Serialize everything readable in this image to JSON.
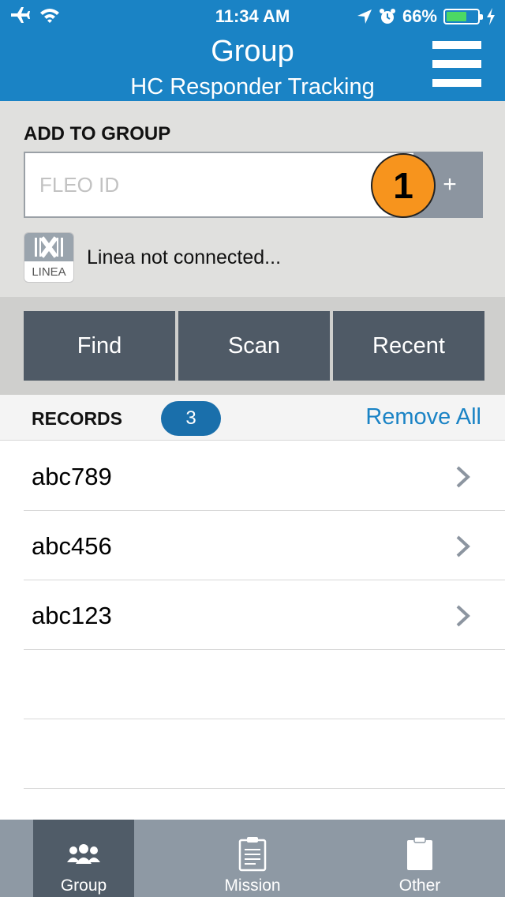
{
  "status_bar": {
    "time": "11:34 AM",
    "battery": "66%",
    "battery_level": 0.66
  },
  "header": {
    "title": "Group",
    "subtitle": "HC Responder Tracking",
    "menu_icon": "hamburger-menu-icon"
  },
  "add_group": {
    "label": "ADD TO GROUP",
    "input_placeholder": "FLEO ID",
    "input_value": "",
    "add_button_label": "+",
    "callout_number": "1",
    "linea_icon_text": "LINEA",
    "linea_status": "Linea not connected..."
  },
  "actions": {
    "find": "Find",
    "scan": "Scan",
    "recent": "Recent"
  },
  "records": {
    "label": "RECORDS",
    "count": "3",
    "remove_all": "Remove All",
    "items": [
      {
        "label": "abc789"
      },
      {
        "label": "abc456"
      },
      {
        "label": "abc123"
      }
    ]
  },
  "tabs": [
    {
      "label": "Group",
      "icon": "people-icon",
      "active": true
    },
    {
      "label": "Mission",
      "icon": "clipboard-document-icon",
      "active": false
    },
    {
      "label": "Other",
      "icon": "clipboard-blank-icon",
      "active": false
    }
  ],
  "colors": {
    "header": "#1a83c5",
    "accent": "#1a83c5",
    "action_button": "#4f5a66",
    "tab_bar": "#8e99a4",
    "tab_active": "#505c68",
    "callout": "#f7941d"
  }
}
